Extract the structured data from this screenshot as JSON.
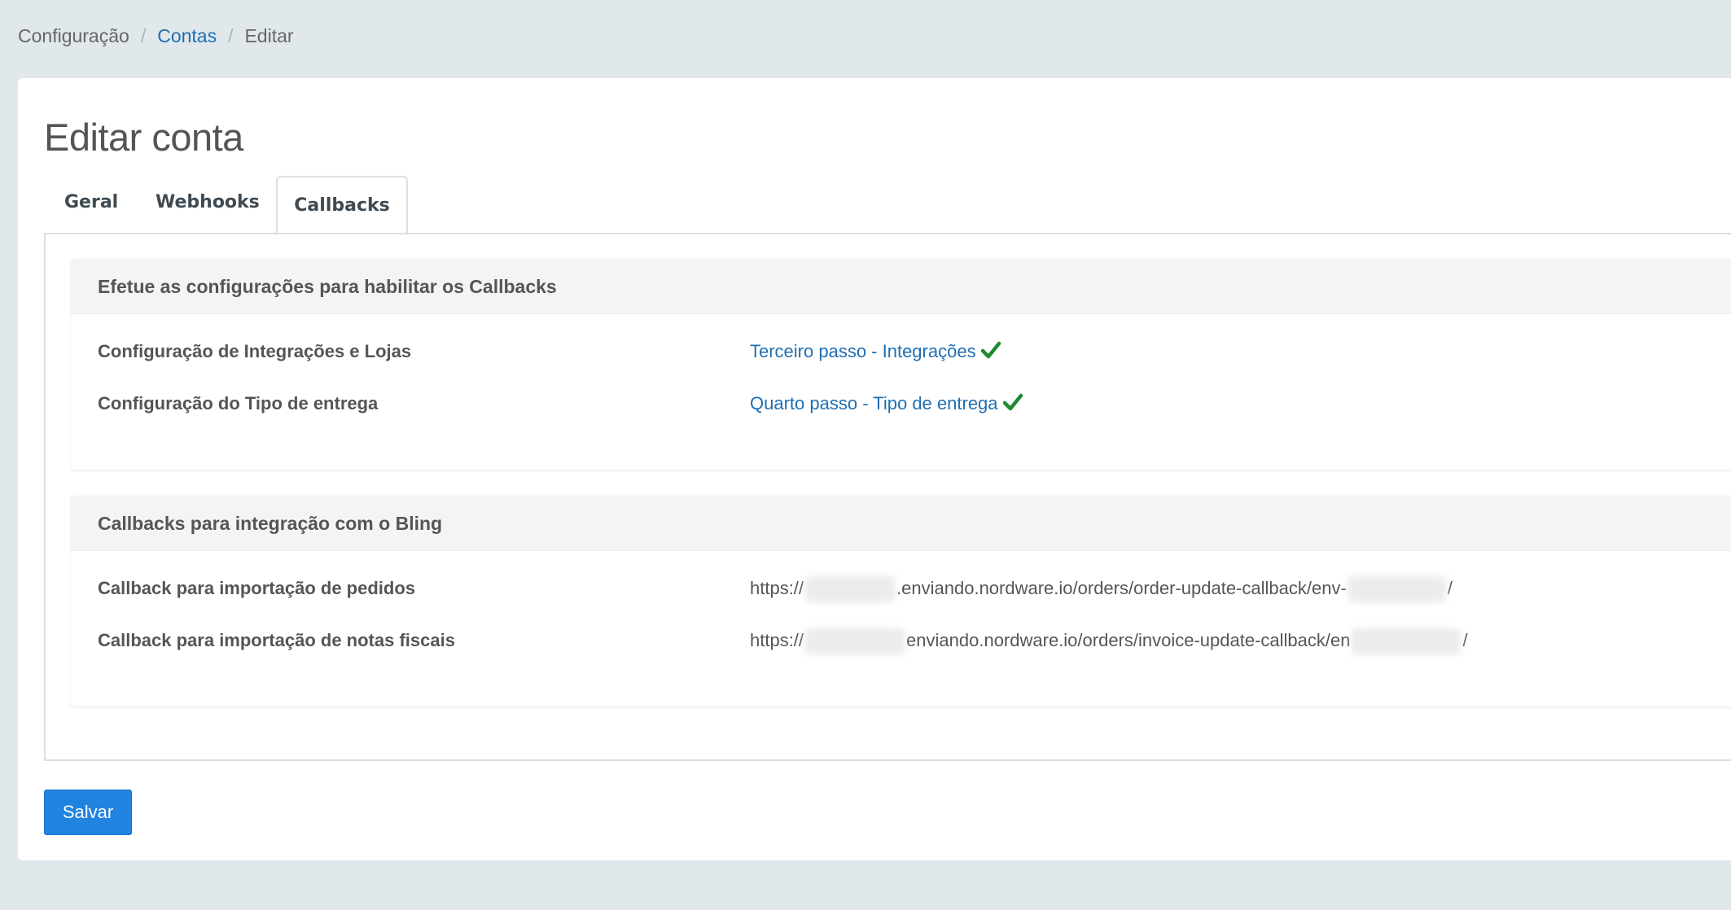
{
  "breadcrumb": {
    "items": [
      "Configuração",
      "Contas",
      "Editar"
    ],
    "separator": "/"
  },
  "page": {
    "title": "Editar conta"
  },
  "tabs": {
    "items": [
      "Geral",
      "Webhooks",
      "Callbacks"
    ],
    "active": "Callbacks"
  },
  "setup_panel": {
    "heading": "Efetue as configurações para habilitar os Callbacks",
    "rows": [
      {
        "label": "Configuração de Integrações e Lojas",
        "link": "Terceiro passo - Integrações",
        "status_icon": "check-icon"
      },
      {
        "label": "Configuração do Tipo de entrega",
        "link": "Quarto passo - Tipo de entrega",
        "status_icon": "check-icon"
      }
    ]
  },
  "callbacks_panel": {
    "heading": "Callbacks para integração com o Bling",
    "rows": [
      {
        "label": "Callback para importação de pedidos",
        "url_prefix": "https://",
        "url_middle": ".enviando.nordware.io/orders/order-update-callback/env-",
        "url_suffix": "/"
      },
      {
        "label": "Callback para importação de notas fiscais",
        "url_prefix": "https://",
        "url_middle": "enviando.nordware.io/orders/invoice-update-callback/en",
        "url_suffix": "/"
      }
    ]
  },
  "actions": {
    "save_label": "Salvar"
  },
  "colors": {
    "background": "#e1e8eb",
    "link": "#1f6fb2",
    "primary_button": "#2183e0",
    "success": "#1e8a2e"
  }
}
